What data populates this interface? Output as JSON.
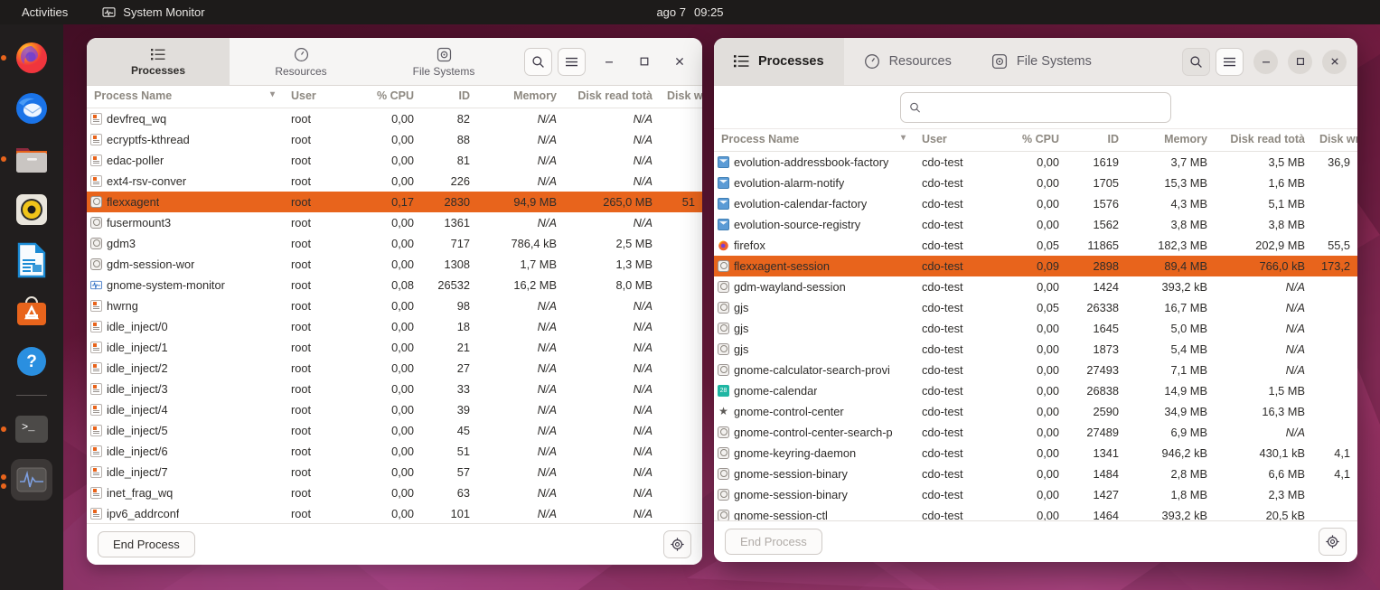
{
  "topbar": {
    "activities": "Activities",
    "app_name": "System Monitor",
    "app_icon": "system-monitor-icon",
    "clock_date": "ago 7",
    "clock_time": "09:25"
  },
  "dock": {
    "items": [
      {
        "name": "firefox",
        "icon": "firefox-icon",
        "running": true
      },
      {
        "name": "thunderbird",
        "icon": "thunderbird-icon",
        "running": false
      },
      {
        "name": "files",
        "icon": "files-folder-icon",
        "running": true
      },
      {
        "name": "rhythmbox",
        "icon": "rhythmbox-speaker-icon",
        "running": false
      },
      {
        "name": "libreoffice-writer",
        "icon": "libreoffice-writer-icon",
        "running": false
      },
      {
        "name": "ubuntu-software",
        "icon": "ubuntu-software-bag-icon",
        "running": false
      },
      {
        "name": "help",
        "icon": "help-question-icon",
        "running": false
      },
      {
        "name": "terminal",
        "icon": "terminal-icon",
        "running": true
      },
      {
        "name": "system-monitor",
        "icon": "system-monitor-wave-icon",
        "running2": true
      }
    ]
  },
  "windows": {
    "left": {
      "tabs": [
        {
          "label": "Processes",
          "icon": "list-icon",
          "selected": true
        },
        {
          "label": "Resources",
          "icon": "gauge-icon",
          "selected": false
        },
        {
          "label": "File Systems",
          "icon": "disk-icon",
          "selected": false
        }
      ],
      "header_buttons": {
        "search": "search-icon",
        "menu": "hamburger-menu-icon",
        "minimize": "–",
        "maximize": "□",
        "close": "✕"
      },
      "columns": [
        "Process Name",
        "User",
        "% CPU",
        "ID",
        "Memory",
        "Disk read totà",
        "Disk w"
      ],
      "sort_column": "Process Name",
      "sort_indicator": "chevron-down-icon",
      "rows": [
        {
          "icon": "kernel",
          "name": "devfreq_wq",
          "user": "root",
          "cpu": "0,00",
          "id": "82",
          "mem": "N/A",
          "read": "N/A",
          "write": "",
          "sel": false
        },
        {
          "icon": "kernel",
          "name": "ecryptfs-kthread",
          "user": "root",
          "cpu": "0,00",
          "id": "88",
          "mem": "N/A",
          "read": "N/A",
          "write": "",
          "sel": false
        },
        {
          "icon": "kernel",
          "name": "edac-poller",
          "user": "root",
          "cpu": "0,00",
          "id": "81",
          "mem": "N/A",
          "read": "N/A",
          "write": "",
          "sel": false
        },
        {
          "icon": "kernel",
          "name": "ext4-rsv-conver",
          "user": "root",
          "cpu": "0,00",
          "id": "226",
          "mem": "N/A",
          "read": "N/A",
          "write": "",
          "sel": false
        },
        {
          "icon": "gear",
          "name": "flexxagent",
          "user": "root",
          "cpu": "0,17",
          "id": "2830",
          "mem": "94,9 MB",
          "read": "265,0 MB",
          "write": "51",
          "sel": true
        },
        {
          "icon": "gear",
          "name": "fusermount3",
          "user": "root",
          "cpu": "0,00",
          "id": "1361",
          "mem": "N/A",
          "read": "N/A",
          "write": "",
          "sel": false
        },
        {
          "icon": "gear",
          "name": "gdm3",
          "user": "root",
          "cpu": "0,00",
          "id": "717",
          "mem": "786,4 kB",
          "read": "2,5 MB",
          "write": "",
          "sel": false
        },
        {
          "icon": "gear",
          "name": "gdm-session-wor",
          "user": "root",
          "cpu": "0,00",
          "id": "1308",
          "mem": "1,7 MB",
          "read": "1,3 MB",
          "write": "",
          "sel": false
        },
        {
          "icon": "monitor",
          "name": "gnome-system-monitor",
          "user": "root",
          "cpu": "0,08",
          "id": "26532",
          "mem": "16,2 MB",
          "read": "8,0 MB",
          "write": "",
          "sel": false
        },
        {
          "icon": "kernel",
          "name": "hwrng",
          "user": "root",
          "cpu": "0,00",
          "id": "98",
          "mem": "N/A",
          "read": "N/A",
          "write": "",
          "sel": false
        },
        {
          "icon": "kernel",
          "name": "idle_inject/0",
          "user": "root",
          "cpu": "0,00",
          "id": "18",
          "mem": "N/A",
          "read": "N/A",
          "write": "",
          "sel": false
        },
        {
          "icon": "kernel",
          "name": "idle_inject/1",
          "user": "root",
          "cpu": "0,00",
          "id": "21",
          "mem": "N/A",
          "read": "N/A",
          "write": "",
          "sel": false
        },
        {
          "icon": "kernel",
          "name": "idle_inject/2",
          "user": "root",
          "cpu": "0,00",
          "id": "27",
          "mem": "N/A",
          "read": "N/A",
          "write": "",
          "sel": false
        },
        {
          "icon": "kernel",
          "name": "idle_inject/3",
          "user": "root",
          "cpu": "0,00",
          "id": "33",
          "mem": "N/A",
          "read": "N/A",
          "write": "",
          "sel": false
        },
        {
          "icon": "kernel",
          "name": "idle_inject/4",
          "user": "root",
          "cpu": "0,00",
          "id": "39",
          "mem": "N/A",
          "read": "N/A",
          "write": "",
          "sel": false
        },
        {
          "icon": "kernel",
          "name": "idle_inject/5",
          "user": "root",
          "cpu": "0,00",
          "id": "45",
          "mem": "N/A",
          "read": "N/A",
          "write": "",
          "sel": false
        },
        {
          "icon": "kernel",
          "name": "idle_inject/6",
          "user": "root",
          "cpu": "0,00",
          "id": "51",
          "mem": "N/A",
          "read": "N/A",
          "write": "",
          "sel": false
        },
        {
          "icon": "kernel",
          "name": "idle_inject/7",
          "user": "root",
          "cpu": "0,00",
          "id": "57",
          "mem": "N/A",
          "read": "N/A",
          "write": "",
          "sel": false
        },
        {
          "icon": "kernel",
          "name": "inet_frag_wq",
          "user": "root",
          "cpu": "0,00",
          "id": "63",
          "mem": "N/A",
          "read": "N/A",
          "write": "",
          "sel": false
        },
        {
          "icon": "kernel",
          "name": "ipv6_addrconf",
          "user": "root",
          "cpu": "0,00",
          "id": "101",
          "mem": "N/A",
          "read": "N/A",
          "write": "",
          "sel": false
        }
      ],
      "end_process_label": "End Process",
      "settings_icon": "gear-settings-icon"
    },
    "right": {
      "tabs": [
        {
          "label": "Processes",
          "icon": "list-icon",
          "selected": true
        },
        {
          "label": "Resources",
          "icon": "gauge-icon",
          "selected": false
        },
        {
          "label": "File Systems",
          "icon": "disk-icon",
          "selected": false
        }
      ],
      "header_buttons": {
        "search": "search-icon",
        "menu": "hamburger-menu-icon",
        "minimize": "–",
        "maximize": "□",
        "close": "✕"
      },
      "search": {
        "value": "",
        "placeholder": "",
        "icon": "search-icon"
      },
      "columns": [
        "Process Name",
        "User",
        "% CPU",
        "ID",
        "Memory",
        "Disk read totà",
        "Disk write"
      ],
      "sort_column": "Process Name",
      "sort_indicator": "chevron-down-icon",
      "rows": [
        {
          "icon": "mail",
          "name": "evolution-addressbook-factory",
          "user": "cdo-test",
          "cpu": "0,00",
          "id": "1619",
          "mem": "3,7 MB",
          "read": "3,5 MB",
          "write": "36,9",
          "sel": false
        },
        {
          "icon": "mail",
          "name": "evolution-alarm-notify",
          "user": "cdo-test",
          "cpu": "0,00",
          "id": "1705",
          "mem": "15,3 MB",
          "read": "1,6 MB",
          "write": "",
          "sel": false
        },
        {
          "icon": "mail",
          "name": "evolution-calendar-factory",
          "user": "cdo-test",
          "cpu": "0,00",
          "id": "1576",
          "mem": "4,3 MB",
          "read": "5,1 MB",
          "write": "",
          "sel": false
        },
        {
          "icon": "mail",
          "name": "evolution-source-registry",
          "user": "cdo-test",
          "cpu": "0,00",
          "id": "1562",
          "mem": "3,8 MB",
          "read": "3,8 MB",
          "write": "",
          "sel": false
        },
        {
          "icon": "firefox",
          "name": "firefox",
          "user": "cdo-test",
          "cpu": "0,05",
          "id": "11865",
          "mem": "182,3 MB",
          "read": "202,9 MB",
          "write": "55,5",
          "sel": false
        },
        {
          "icon": "gear",
          "name": "flexxagent-session",
          "user": "cdo-test",
          "cpu": "0,09",
          "id": "2898",
          "mem": "89,4 MB",
          "read": "766,0 kB",
          "write": "173,2",
          "sel": true
        },
        {
          "icon": "gear",
          "name": "gdm-wayland-session",
          "user": "cdo-test",
          "cpu": "0,00",
          "id": "1424",
          "mem": "393,2 kB",
          "read": "N/A",
          "write": "",
          "sel": false
        },
        {
          "icon": "gear",
          "name": "gjs",
          "user": "cdo-test",
          "cpu": "0,05",
          "id": "26338",
          "mem": "16,7 MB",
          "read": "N/A",
          "write": "",
          "sel": false
        },
        {
          "icon": "gear",
          "name": "gjs",
          "user": "cdo-test",
          "cpu": "0,00",
          "id": "1645",
          "mem": "5,0 MB",
          "read": "N/A",
          "write": "",
          "sel": false
        },
        {
          "icon": "gear",
          "name": "gjs",
          "user": "cdo-test",
          "cpu": "0,00",
          "id": "1873",
          "mem": "5,4 MB",
          "read": "N/A",
          "write": "",
          "sel": false
        },
        {
          "icon": "gear",
          "name": "gnome-calculator-search-provi",
          "user": "cdo-test",
          "cpu": "0,00",
          "id": "27493",
          "mem": "7,1 MB",
          "read": "N/A",
          "write": "",
          "sel": false
        },
        {
          "icon": "calendar",
          "name": "gnome-calendar",
          "user": "cdo-test",
          "cpu": "0,00",
          "id": "26838",
          "mem": "14,9 MB",
          "read": "1,5 MB",
          "write": "",
          "sel": false
        },
        {
          "icon": "star",
          "name": "gnome-control-center",
          "user": "cdo-test",
          "cpu": "0,00",
          "id": "2590",
          "mem": "34,9 MB",
          "read": "16,3 MB",
          "write": "",
          "sel": false
        },
        {
          "icon": "gear",
          "name": "gnome-control-center-search-p",
          "user": "cdo-test",
          "cpu": "0,00",
          "id": "27489",
          "mem": "6,9 MB",
          "read": "N/A",
          "write": "",
          "sel": false
        },
        {
          "icon": "gear",
          "name": "gnome-keyring-daemon",
          "user": "cdo-test",
          "cpu": "0,00",
          "id": "1341",
          "mem": "946,2 kB",
          "read": "430,1 kB",
          "write": "4,1",
          "sel": false
        },
        {
          "icon": "gear",
          "name": "gnome-session-binary",
          "user": "cdo-test",
          "cpu": "0,00",
          "id": "1484",
          "mem": "2,8 MB",
          "read": "6,6 MB",
          "write": "4,1",
          "sel": false
        },
        {
          "icon": "gear",
          "name": "gnome-session-binary",
          "user": "cdo-test",
          "cpu": "0,00",
          "id": "1427",
          "mem": "1,8 MB",
          "read": "2,3 MB",
          "write": "",
          "sel": false
        },
        {
          "icon": "gear",
          "name": "gnome-session-ctl",
          "user": "cdo-test",
          "cpu": "0,00",
          "id": "1464",
          "mem": "393,2 kB",
          "read": "20,5 kB",
          "write": "",
          "sel": false
        }
      ],
      "end_process_label": "End Process",
      "settings_icon": "gear-settings-icon"
    }
  },
  "colors": {
    "selection": "#e8641c",
    "topbar_bg": "#1d1b1a",
    "dock_bg": "#211e1e"
  }
}
